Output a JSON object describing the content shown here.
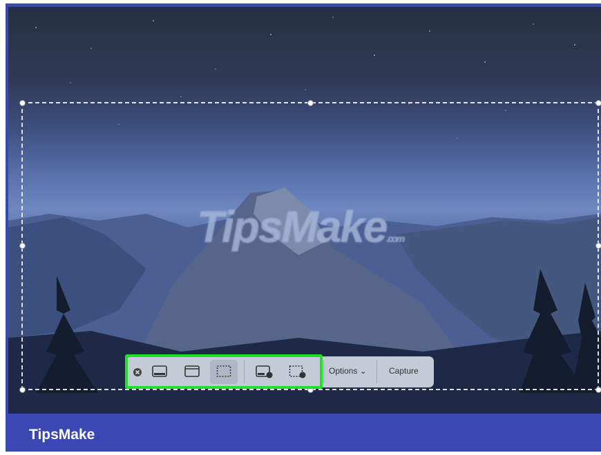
{
  "watermark": {
    "text": "TipsMake",
    "suffix": ".com"
  },
  "toolbar": {
    "close_icon": "close-circle-icon",
    "capture_entire_screen_icon": "entire-screen-icon",
    "capture_window_icon": "window-icon",
    "capture_selection_icon": "selection-icon",
    "record_screen_icon": "record-screen-icon",
    "record_selection_icon": "record-selection-icon",
    "options_label": "Options",
    "capture_label": "Capture"
  },
  "footer": {
    "brand": "TipsMake"
  },
  "colors": {
    "frame": "#3b47b3",
    "highlight": "#22e02a"
  }
}
